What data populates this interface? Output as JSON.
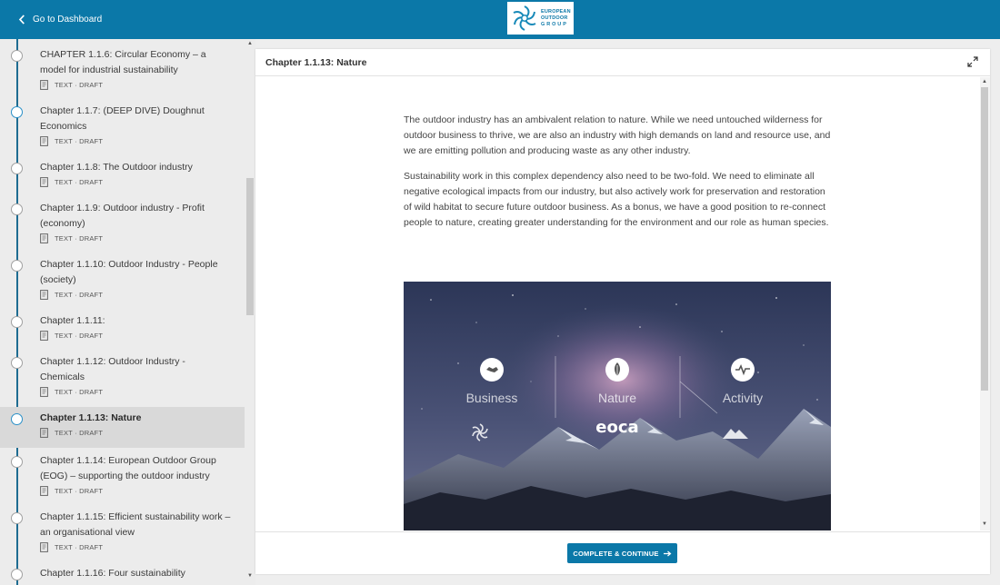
{
  "header": {
    "back_label": "Go to Dashboard",
    "logo_lines": [
      "EUROPEAN",
      "OUTDOOR",
      "G R O U P"
    ]
  },
  "sidebar": {
    "items": [
      {
        "title": "CHAPTER 1.1.6: Circular Economy – a model for industrial sustainability",
        "meta": "TEXT · DRAFT"
      },
      {
        "title": "Chapter 1.1.7: (DEEP DIVE) Doughnut Economics",
        "meta": "TEXT · DRAFT"
      },
      {
        "title": "Chapter 1.1.8: The Outdoor industry",
        "meta": "TEXT · DRAFT"
      },
      {
        "title": "Chapter 1.1.9: Outdoor industry - Profit (economy)",
        "meta": "TEXT · DRAFT"
      },
      {
        "title": "Chapter 1.1.10: Outdoor Industry - People (society)",
        "meta": "TEXT · DRAFT"
      },
      {
        "title": "Chapter 1.1.11:",
        "meta": "TEXT · DRAFT"
      },
      {
        "title": "Chapter 1.1.12: Outdoor Industry - Chemicals",
        "meta": "TEXT · DRAFT"
      },
      {
        "title": "Chapter 1.1.13: Nature",
        "meta": "TEXT · DRAFT"
      },
      {
        "title": "Chapter 1.1.14: European Outdoor Group (EOG) – supporting the outdoor industry",
        "meta": "TEXT · DRAFT"
      },
      {
        "title": "Chapter 1.1.15: Efficient sustainability work – an organisational view",
        "meta": "TEXT · DRAFT"
      },
      {
        "title": "Chapter 1.1.16: Four sustainability",
        "meta": ""
      }
    ]
  },
  "lesson": {
    "title": "Chapter 1.1.13: Nature",
    "paragraph_1": "The outdoor industry has an ambivalent relation to nature. While we need untouched wilderness for outdoor business to thrive, we are also an industry with high demands on land and resource use, and we are emitting pollution and producing waste as any other industry.",
    "paragraph_2": "Sustainability work in this complex dependency also need to be two-fold. We need to eliminate all negative ecological impacts from our industry, but also actively work for preservation and restoration of wild habitat to secure future outdoor business. As a bonus, we have a good position to re-connect people to nature, creating greater understanding for the environment and our role as human species.",
    "image": {
      "labels": [
        "Business",
        "Nature",
        "Activity"
      ],
      "logo_eoca": "eoca"
    }
  },
  "footer": {
    "cta_label": "COMPLETE & CONTINUE"
  },
  "colors": {
    "brand": "#0b78a8",
    "timeline": "#1e6c91",
    "active_dot": "#2a90c8"
  }
}
